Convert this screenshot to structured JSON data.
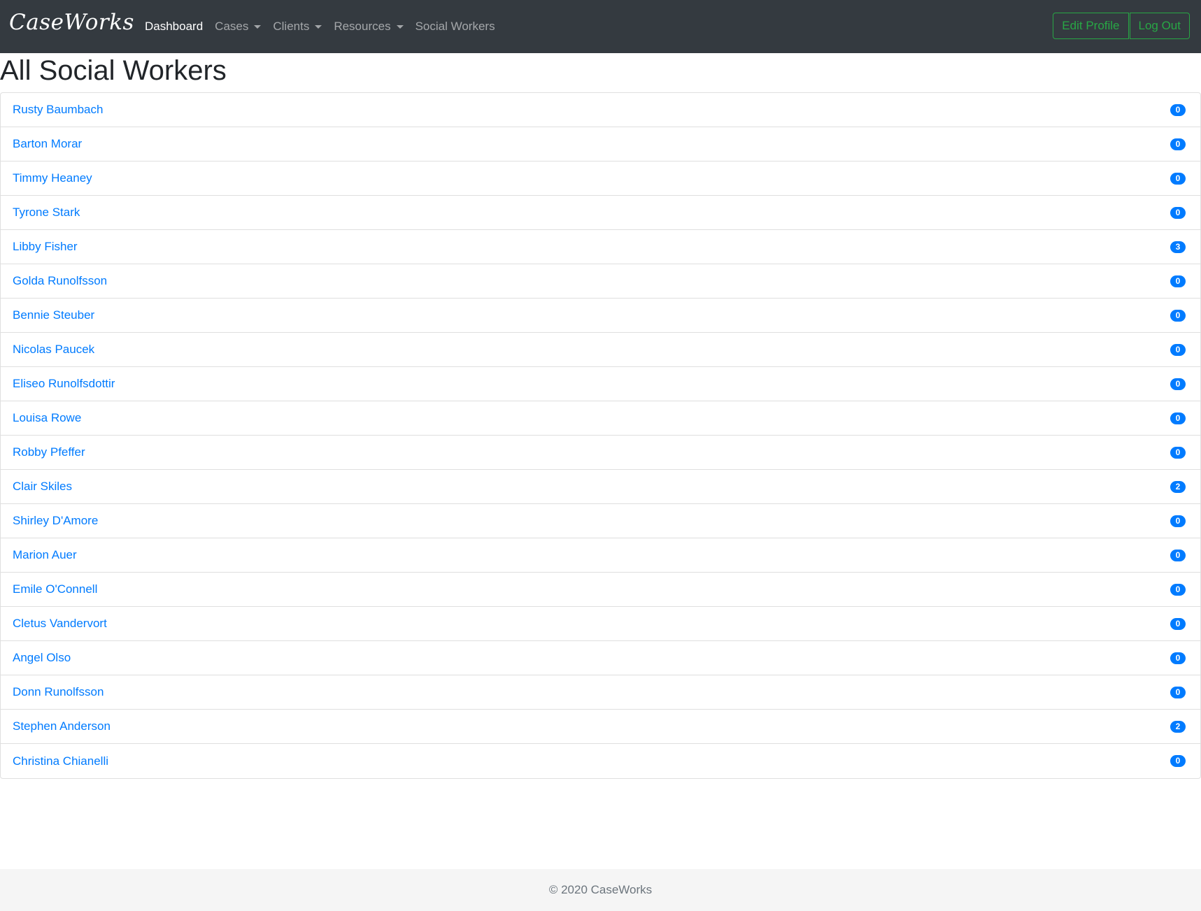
{
  "navbar": {
    "brand": "CaseWorks",
    "links": [
      {
        "label": "Dashboard",
        "active": true,
        "dropdown": false
      },
      {
        "label": "Cases",
        "active": false,
        "dropdown": true
      },
      {
        "label": "Clients",
        "active": false,
        "dropdown": true
      },
      {
        "label": "Resources",
        "active": false,
        "dropdown": true
      },
      {
        "label": "Social Workers",
        "active": false,
        "dropdown": false
      }
    ],
    "edit_profile_label": "Edit Profile",
    "logout_label": "Log Out"
  },
  "page": {
    "title": "All Social Workers"
  },
  "workers": [
    {
      "name": "Rusty Baumbach",
      "count": "0"
    },
    {
      "name": "Barton Morar",
      "count": "0"
    },
    {
      "name": "Timmy Heaney",
      "count": "0"
    },
    {
      "name": "Tyrone Stark",
      "count": "0"
    },
    {
      "name": "Libby Fisher",
      "count": "3"
    },
    {
      "name": "Golda Runolfsson",
      "count": "0"
    },
    {
      "name": "Bennie Steuber",
      "count": "0"
    },
    {
      "name": "Nicolas Paucek",
      "count": "0"
    },
    {
      "name": "Eliseo Runolfsdottir",
      "count": "0"
    },
    {
      "name": "Louisa Rowe",
      "count": "0"
    },
    {
      "name": "Robby Pfeffer",
      "count": "0"
    },
    {
      "name": "Clair Skiles",
      "count": "2"
    },
    {
      "name": "Shirley D'Amore",
      "count": "0"
    },
    {
      "name": "Marion Auer",
      "count": "0"
    },
    {
      "name": "Emile O'Connell",
      "count": "0"
    },
    {
      "name": "Cletus Vandervort",
      "count": "0"
    },
    {
      "name": "Angel Olso",
      "count": "0"
    },
    {
      "name": "Donn Runolfsson",
      "count": "0"
    },
    {
      "name": "Stephen Anderson",
      "count": "2"
    },
    {
      "name": "Christina Chianelli",
      "count": "0"
    }
  ],
  "footer": {
    "text": "© 2020 CaseWorks"
  },
  "colors": {
    "navbar_bg": "#343a40",
    "link": "#007bff",
    "badge": "#007bff",
    "success_outline": "#28a745",
    "footer_bg": "#f5f5f5"
  }
}
